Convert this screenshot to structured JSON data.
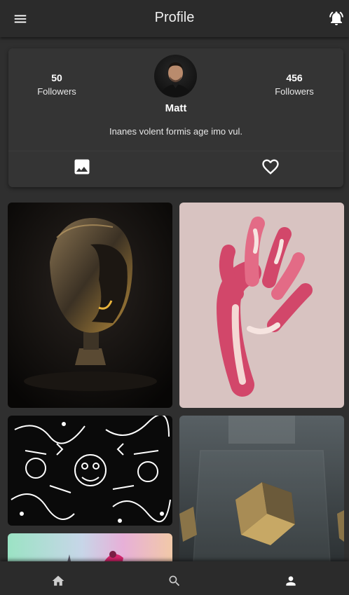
{
  "header": {
    "title": "Profile",
    "menu_icon": "menu-icon",
    "notifications_icon": "notifications-active-icon"
  },
  "profile": {
    "name": "Matt",
    "bio": "Inanes volent formis age imo vul.",
    "stats": [
      {
        "value": "50",
        "label": "Followers"
      },
      {
        "value": "456",
        "label": "Followers"
      }
    ],
    "actions": {
      "gallery_icon": "image-icon",
      "favorites_icon": "heart-outline-icon"
    }
  },
  "gallery": {
    "items": [
      {
        "subject": "golden-bust-sculpture"
      },
      {
        "subject": "pink-striped-hand"
      },
      {
        "subject": "black-white-doodle-pattern"
      },
      {
        "subject": "gold-crystal-in-glass-box"
      },
      {
        "subject": "pastel-gradient-scene"
      }
    ]
  },
  "bottom_nav": {
    "items": [
      {
        "id": "home",
        "icon": "home-icon"
      },
      {
        "id": "search",
        "icon": "search-icon"
      },
      {
        "id": "profile",
        "icon": "person-icon"
      }
    ]
  },
  "colors": {
    "background": "#2f2f2f",
    "bar": "#2b2b2b",
    "card": "#343434",
    "text": "#ffffff"
  }
}
